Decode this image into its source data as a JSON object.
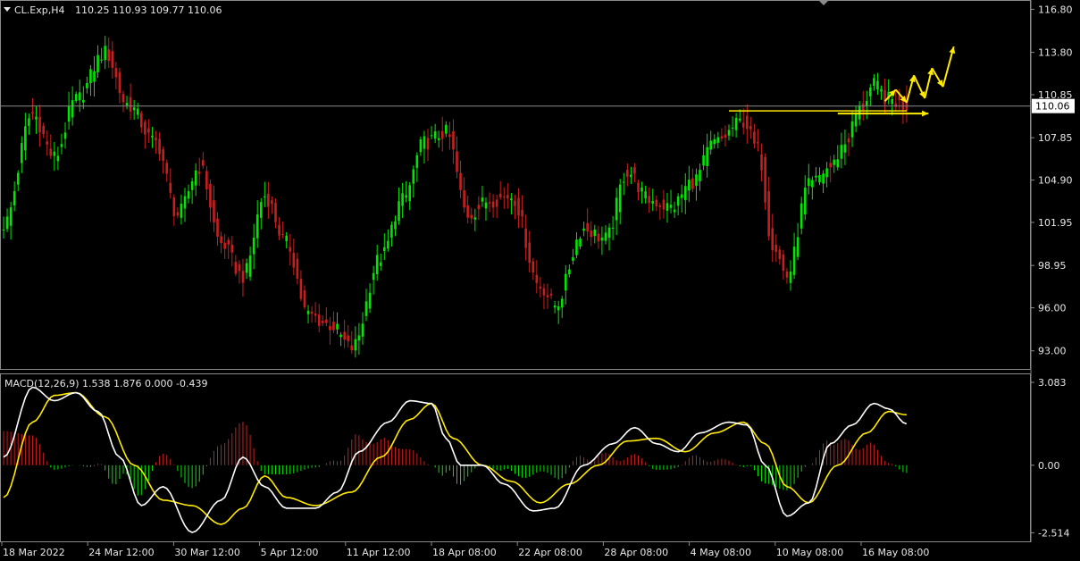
{
  "header": {
    "symbol": "CL.Exp,H4",
    "ohlc": "110.25 110.93 109.77 110.06"
  },
  "indicator": {
    "label": "MACD(12,26,9) 1.538 1.876 0.000 -0.439"
  },
  "colors": {
    "background": "#000000",
    "bull": "#00e600",
    "bear": "#c81e1e",
    "signal": "#ffea00",
    "macd": "#ffffff",
    "price_line": "#8c8c8c",
    "annotation": "#ffea00"
  },
  "chart_data": [
    {
      "type": "candlestick",
      "symbol": "CL.Exp",
      "timeframe": "H4",
      "ylim": [
        91.8,
        117.2
      ],
      "yticks": [
        "116.80",
        "113.80",
        "110.85",
        "107.85",
        "104.90",
        "101.95",
        "98.95",
        "96.00",
        "93.00"
      ],
      "ytick_values": [
        116.8,
        113.8,
        110.85,
        107.85,
        104.9,
        101.95,
        98.95,
        96.0,
        93.0
      ],
      "current_price": 110.06,
      "current_price_label": "110.06",
      "xticks": [
        "18 Mar 2022",
        "24 Mar 12:00",
        "30 Mar 12:00",
        "5 Apr 12:00",
        "11 Apr 12:00",
        "18 Apr 08:00",
        "22 Apr 08:00",
        "28 Apr 08:00",
        "4 May 08:00",
        "10 May 08:00",
        "16 May 08:00"
      ],
      "bar_count": 250,
      "close_anchors": [
        [
          0,
          101.8
        ],
        [
          8,
          109.5
        ],
        [
          14,
          106.5
        ],
        [
          20,
          110.5
        ],
        [
          28,
          113.8
        ],
        [
          34,
          110.2
        ],
        [
          42,
          107.5
        ],
        [
          48,
          102.5
        ],
        [
          54,
          105.8
        ],
        [
          60,
          100.5
        ],
        [
          66,
          98.2
        ],
        [
          72,
          103.8
        ],
        [
          78,
          100.5
        ],
        [
          84,
          95.5
        ],
        [
          90,
          94.8
        ],
        [
          96,
          93.2
        ],
        [
          104,
          99.5
        ],
        [
          110,
          103.5
        ],
        [
          116,
          107.5
        ],
        [
          122,
          108.2
        ],
        [
          128,
          102.5
        ],
        [
          134,
          103.5
        ],
        [
          140,
          103.8
        ],
        [
          148,
          97.5
        ],
        [
          152,
          96.2
        ],
        [
          160,
          101.5
        ],
        [
          166,
          100.8
        ],
        [
          172,
          105.5
        ],
        [
          178,
          103.5
        ],
        [
          184,
          103.0
        ],
        [
          190,
          104.8
        ],
        [
          196,
          107.5
        ],
        [
          204,
          109.0
        ],
        [
          208,
          107.0
        ],
        [
          212,
          100.5
        ],
        [
          216,
          98.2
        ],
        [
          222,
          104.5
        ],
        [
          228,
          105.8
        ],
        [
          232,
          107.5
        ],
        [
          236,
          109.8
        ],
        [
          240,
          111.5
        ],
        [
          244,
          110.5
        ],
        [
          249,
          110.06
        ]
      ],
      "annotations": {
        "support_line_price": 109.6,
        "forecast_zigzag": [
          [
            243,
            110.4
          ],
          [
            246,
            111.2
          ],
          [
            249,
            110.3
          ],
          [
            251,
            112.2
          ],
          [
            254,
            110.6
          ],
          [
            256,
            112.7
          ],
          [
            259,
            111.4
          ],
          [
            262,
            114.2
          ]
        ]
      }
    },
    {
      "type": "macd",
      "params": "12,26,9",
      "ylim": [
        -2.8,
        3.35
      ],
      "yticks": [
        "3.083",
        "0.00",
        "-2.514"
      ],
      "ytick_values": [
        3.083,
        0.0,
        -2.514
      ],
      "macd_anchors": [
        [
          0,
          0.3
        ],
        [
          8,
          2.9
        ],
        [
          14,
          2.4
        ],
        [
          20,
          2.7
        ],
        [
          26,
          2.0
        ],
        [
          32,
          0.3
        ],
        [
          38,
          -1.5
        ],
        [
          44,
          -0.8
        ],
        [
          52,
          -2.5
        ],
        [
          60,
          -1.3
        ],
        [
          66,
          0.3
        ],
        [
          72,
          -0.8
        ],
        [
          78,
          -1.6
        ],
        [
          86,
          -1.6
        ],
        [
          92,
          -1.0
        ],
        [
          98,
          0.5
        ],
        [
          106,
          1.6
        ],
        [
          112,
          2.4
        ],
        [
          118,
          2.3
        ],
        [
          122,
          1.0
        ],
        [
          126,
          0.0
        ],
        [
          132,
          0.0
        ],
        [
          138,
          -0.7
        ],
        [
          146,
          -1.7
        ],
        [
          152,
          -1.6
        ],
        [
          160,
          0.0
        ],
        [
          168,
          0.8
        ],
        [
          174,
          1.4
        ],
        [
          180,
          0.8
        ],
        [
          186,
          0.5
        ],
        [
          192,
          1.2
        ],
        [
          200,
          1.6
        ],
        [
          205,
          1.5
        ],
        [
          210,
          0.0
        ],
        [
          216,
          -1.9
        ],
        [
          222,
          -1.4
        ],
        [
          228,
          0.8
        ],
        [
          234,
          1.5
        ],
        [
          240,
          2.3
        ],
        [
          244,
          2.1
        ],
        [
          249,
          1.538
        ]
      ],
      "signal_anchors": [
        [
          0,
          -1.2
        ],
        [
          8,
          1.6
        ],
        [
          14,
          2.6
        ],
        [
          20,
          2.7
        ],
        [
          28,
          1.8
        ],
        [
          36,
          0.0
        ],
        [
          44,
          -1.3
        ],
        [
          52,
          -1.5
        ],
        [
          60,
          -2.2
        ],
        [
          66,
          -1.6
        ],
        [
          72,
          -0.4
        ],
        [
          78,
          -1.2
        ],
        [
          86,
          -1.5
        ],
        [
          96,
          -1.0
        ],
        [
          104,
          0.3
        ],
        [
          112,
          1.7
        ],
        [
          118,
          2.3
        ],
        [
          124,
          1.0
        ],
        [
          132,
          0.0
        ],
        [
          140,
          -0.6
        ],
        [
          148,
          -1.4
        ],
        [
          156,
          -0.7
        ],
        [
          164,
          0.0
        ],
        [
          172,
          0.9
        ],
        [
          180,
          1.0
        ],
        [
          188,
          0.5
        ],
        [
          196,
          1.2
        ],
        [
          204,
          1.6
        ],
        [
          210,
          0.8
        ],
        [
          216,
          -0.8
        ],
        [
          222,
          -1.4
        ],
        [
          230,
          0.0
        ],
        [
          238,
          1.2
        ],
        [
          244,
          2.0
        ],
        [
          249,
          1.876
        ]
      ]
    }
  ]
}
